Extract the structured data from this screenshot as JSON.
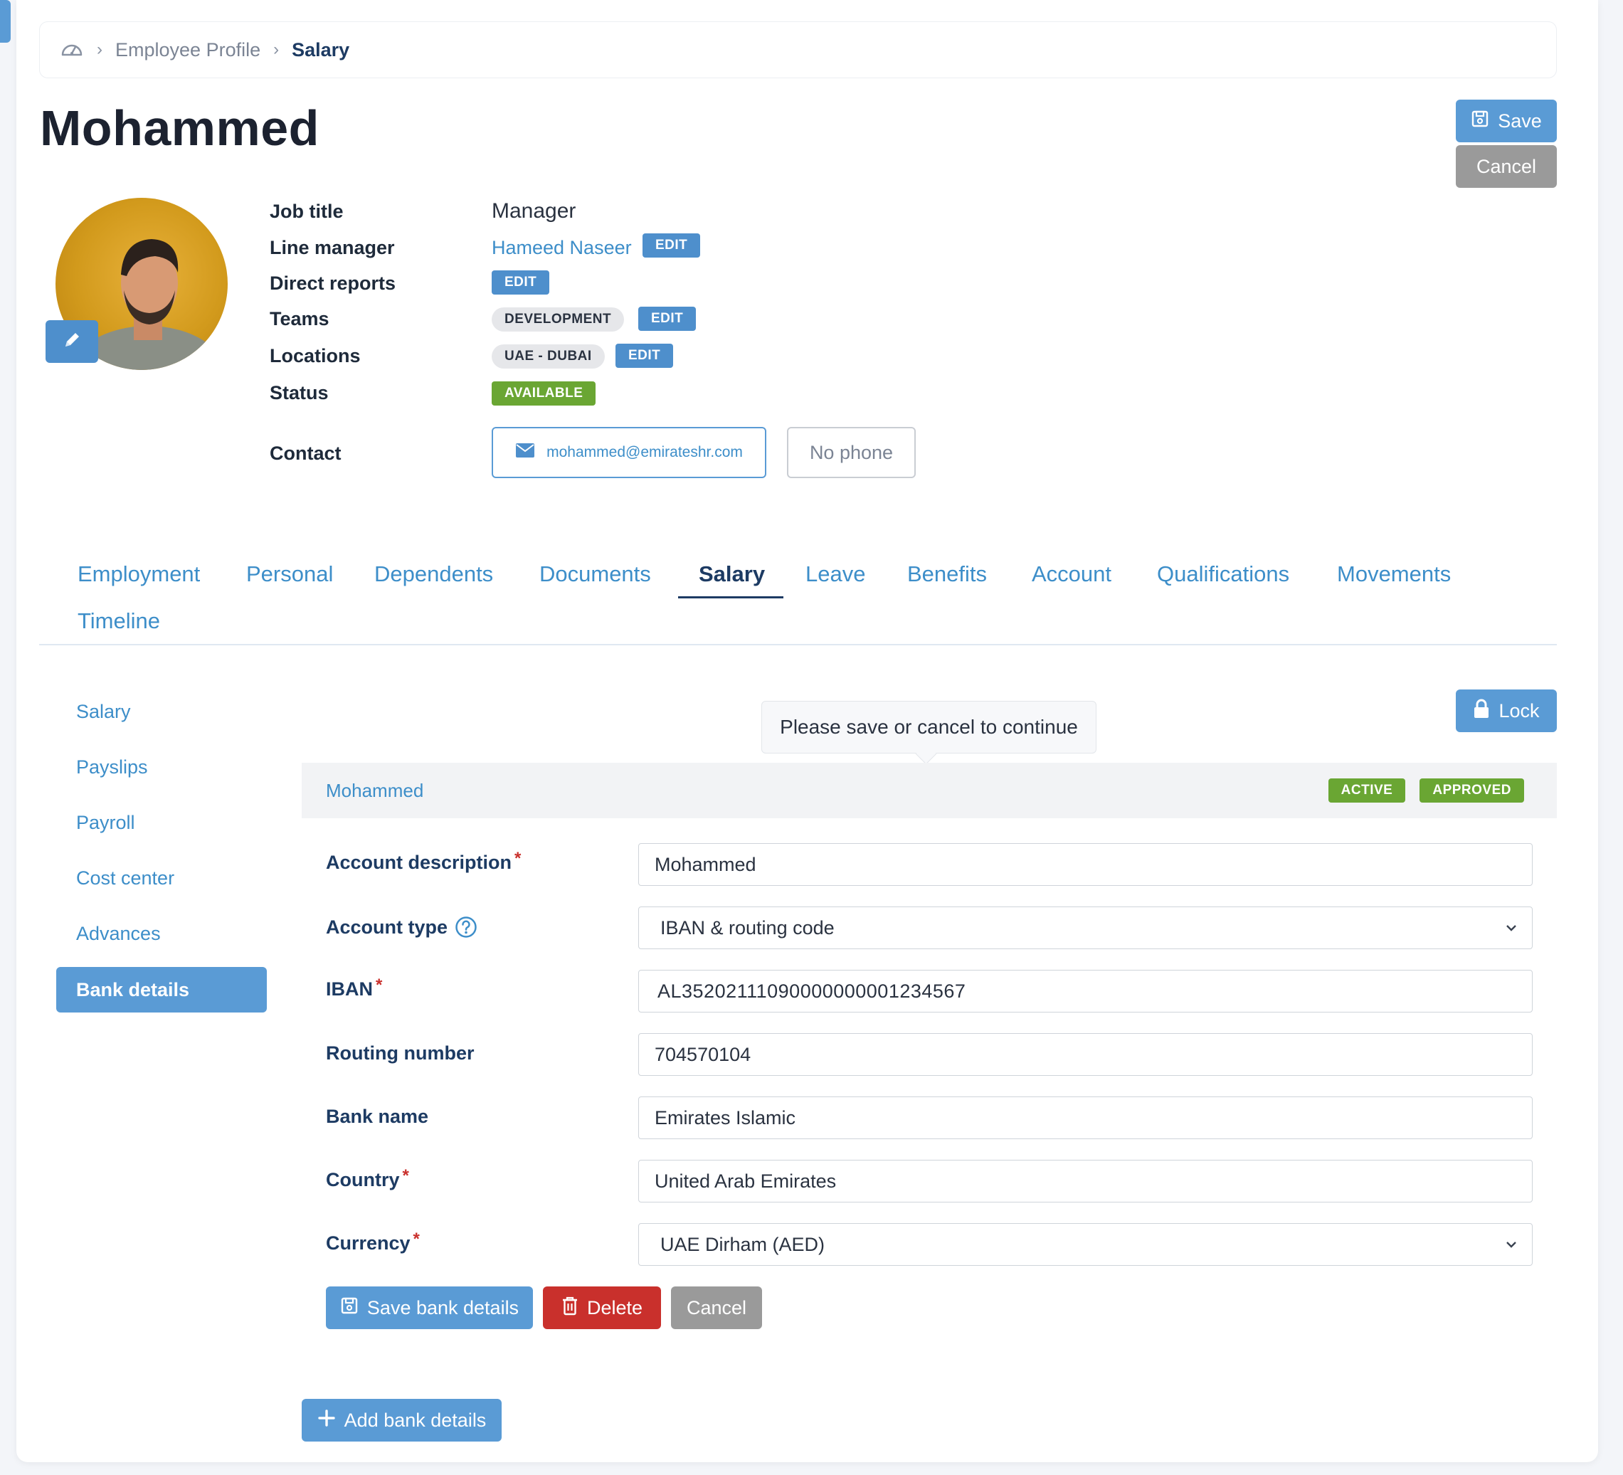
{
  "breadcrumb": {
    "parent": "Employee Profile",
    "current": "Salary"
  },
  "employee": {
    "name": "Mohammed",
    "job_title_label": "Job title",
    "job_title": "Manager",
    "line_manager_label": "Line manager",
    "line_manager": "Hameed Naseer",
    "direct_reports_label": "Direct reports",
    "teams_label": "Teams",
    "team": "DEVELOPMENT",
    "locations_label": "Locations",
    "location": "UAE - DUBAI",
    "status_label": "Status",
    "status": "AVAILABLE",
    "contact_label": "Contact",
    "email": "mohammed@emirateshr.com",
    "phone": "No phone",
    "edit_label": "EDIT"
  },
  "header_actions": {
    "save": "Save",
    "cancel": "Cancel"
  },
  "tabs": [
    {
      "label": "Employment"
    },
    {
      "label": "Personal"
    },
    {
      "label": "Dependents"
    },
    {
      "label": "Documents"
    },
    {
      "label": "Salary"
    },
    {
      "label": "Leave"
    },
    {
      "label": "Benefits"
    },
    {
      "label": "Account"
    },
    {
      "label": "Qualifications"
    },
    {
      "label": "Movements"
    },
    {
      "label": "Timeline"
    }
  ],
  "active_tab": "Salary",
  "sidebar": {
    "items": [
      {
        "label": "Salary"
      },
      {
        "label": "Payslips"
      },
      {
        "label": "Payroll"
      },
      {
        "label": "Cost center"
      },
      {
        "label": "Advances"
      },
      {
        "label": "Bank details"
      }
    ],
    "active": "Bank details"
  },
  "tooltip": "Please save or cancel to continue",
  "lock_label": "Lock",
  "bank_panel": {
    "title": "Mohammed",
    "badges": [
      "ACTIVE",
      "APPROVED"
    ],
    "fields": {
      "account_description": {
        "label": "Account description",
        "value": "Mohammed"
      },
      "account_type": {
        "label": "Account type",
        "value": "IBAN & routing code"
      },
      "iban": {
        "label": "IBAN",
        "value": "AL35202111090000000001234567"
      },
      "routing_number": {
        "label": "Routing number",
        "value": "704570104"
      },
      "bank_name": {
        "label": "Bank name",
        "value": "Emirates Islamic"
      },
      "country": {
        "label": "Country",
        "value": "United Arab Emirates"
      },
      "currency": {
        "label": "Currency",
        "value": "UAE Dirham (AED)"
      }
    },
    "save_label": "Save bank details",
    "delete_label": "Delete",
    "cancel_label": "Cancel"
  },
  "add_bank_label": "Add bank details",
  "colors": {
    "primary": "#5a9bd5",
    "link": "#3d8ec9",
    "success": "#6aa633",
    "danger": "#c9302c",
    "neutral": "#9a9a9a",
    "heading": "#1d3b63"
  }
}
